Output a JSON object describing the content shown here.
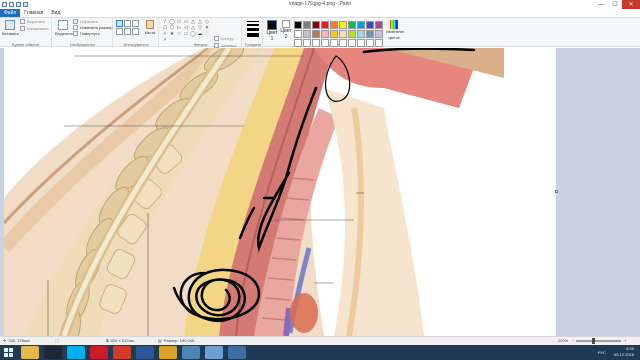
{
  "window": {
    "title": "image-179.jpg-4.png - Paint",
    "minimize": "—",
    "maximize": "☐",
    "close": "✕"
  },
  "tabs": [
    "Файл",
    "Главная",
    "Вид"
  ],
  "ribbon": {
    "clipboard": {
      "paste": "Вставить",
      "cut": "Вырезать",
      "copy": "Копировать",
      "label": "Буфер обмена"
    },
    "image": {
      "select": "Выделить",
      "crop": "Обрезать",
      "resize": "Изменить размер",
      "rotate": "Повернуть",
      "label": "Изображение"
    },
    "tools": {
      "label": "Инструменты",
      "brushes": "Кисти"
    },
    "shapes": {
      "label": "Фигуры",
      "outline": "Контур",
      "fill": "Заливка",
      "glyphs": [
        "/",
        "◯",
        "▭",
        "▭",
        "△",
        "△",
        "◇",
        "⬠",
        "⬡",
        "▷",
        "◁",
        "△",
        "▽",
        "✦",
        "✧",
        "★",
        "☆",
        "▭",
        "◯",
        "☁",
        "♡",
        "⚡"
      ]
    },
    "size": {
      "label": "Толщина"
    },
    "colors": {
      "color1": "Цвет 1",
      "color2": "Цвет 2",
      "edit": "Изменение цветов",
      "label": "Цвета",
      "color1_hex": "#000000",
      "color2_hex": "#ffffff",
      "palette": [
        "#000000",
        "#7f7f7f",
        "#880015",
        "#ed1c24",
        "#ff7f27",
        "#fff200",
        "#22b14c",
        "#00a2e8",
        "#3f48cc",
        "#a349a4",
        "#ffffff",
        "#c3c3c3",
        "#b97a57",
        "#ffaec9",
        "#ffc90e",
        "#efe4b0",
        "#b5e61d",
        "#99d9ea",
        "#7092be",
        "#c8bfe7",
        "#ffffff",
        "#ffffff",
        "#ffffff",
        "#ffffff",
        "#ffffff",
        "#ffffff",
        "#ffffff",
        "#ffffff",
        "#ffffff",
        "#ffffff"
      ]
    }
  },
  "status": {
    "cursor_pos": "330, 378пкс",
    "selection_size": "",
    "image_size": "820 × 612пкс",
    "file_size": "Размер: 190,0КБ",
    "zoom": "200%"
  },
  "taskbar": {
    "apps": [
      {
        "name": "explorer",
        "color": "#e6b84a"
      },
      {
        "name": "steam",
        "color": "#1b2838"
      },
      {
        "name": "skype",
        "color": "#00aff0"
      },
      {
        "name": "opera",
        "color": "#cc1b2b"
      },
      {
        "name": "ccleaner",
        "color": "#d43a2a"
      },
      {
        "name": "word",
        "color": "#2b5797"
      },
      {
        "name": "chrome",
        "color": "#d9a227"
      },
      {
        "name": "daemon",
        "color": "#4b87b5"
      },
      {
        "name": "paint",
        "color": "#6d9fd1"
      },
      {
        "name": "totalcmd",
        "color": "#3a6ea5"
      }
    ],
    "lang": "РУС",
    "time": "8:30",
    "date": "05.12.2015"
  }
}
